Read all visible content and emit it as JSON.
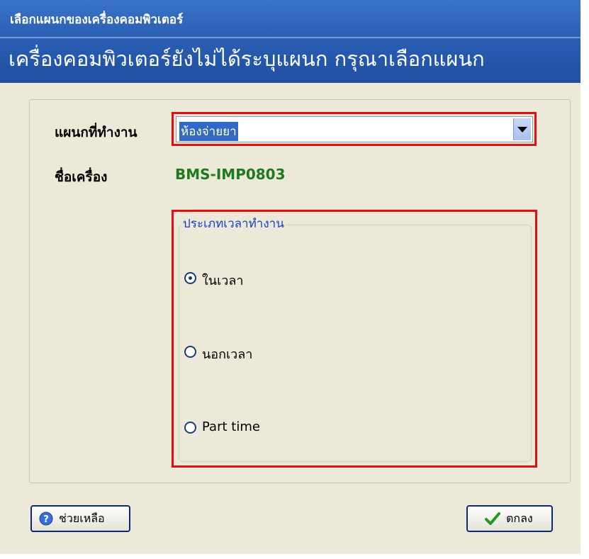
{
  "window": {
    "title": "เลือกแผนกของเครื่องคอมพิวเตอร์",
    "heading": "เครื่องคอมพิวเตอร์ยังไม่ได้ระบุแผนก กรุณาเลือกแผนก"
  },
  "form": {
    "department_label": "แผนกที่ทำงาน",
    "department_value": "ห้องจ่ายยา",
    "machine_label": "ชื่อเครื่อง",
    "machine_value": "BMS-IMP0803"
  },
  "work_type": {
    "title": "ประเภทเวลาทำงาน",
    "options": [
      {
        "label": "ในเวลา",
        "selected": true
      },
      {
        "label": "นอกเวลา",
        "selected": false
      },
      {
        "label": "Part time",
        "selected": false
      }
    ]
  },
  "buttons": {
    "help": "ช่วยเหลือ",
    "ok": "ตกลง"
  },
  "colors": {
    "banner": "#2a5fb4",
    "highlight_border": "#e01010",
    "machine_name": "#1e7a1e",
    "group_title": "#1a40c8"
  }
}
